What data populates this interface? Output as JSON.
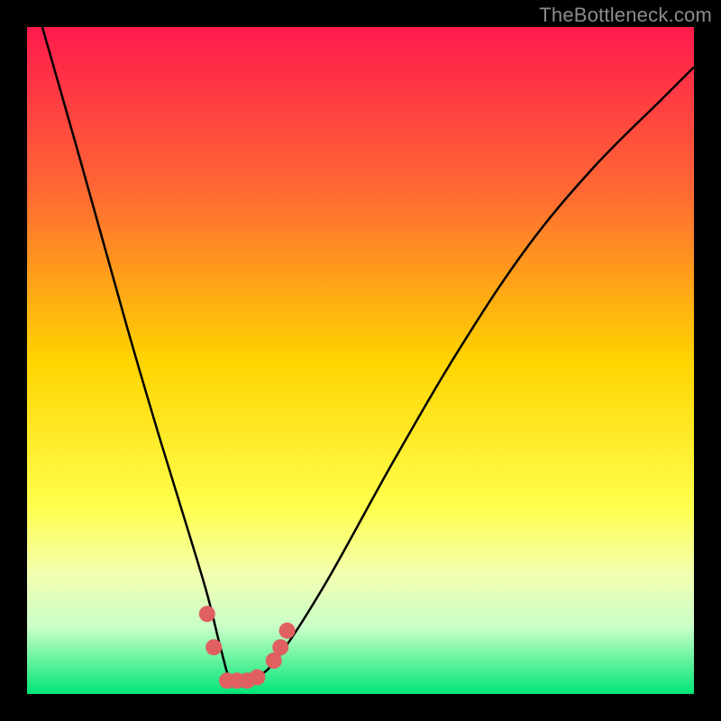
{
  "watermark": "TheBottleneck.com",
  "chart_data": {
    "type": "line",
    "title": "",
    "xlabel": "",
    "ylabel": "",
    "xlim": [
      0,
      100
    ],
    "ylim": [
      0,
      100
    ],
    "background_gradient": {
      "stops": [
        {
          "offset": 0,
          "color": "#ff1a4d"
        },
        {
          "offset": 25,
          "color": "#ff6a33"
        },
        {
          "offset": 50,
          "color": "#ffd400"
        },
        {
          "offset": 72,
          "color": "#ffff4d"
        },
        {
          "offset": 82,
          "color": "#f3ffb0"
        },
        {
          "offset": 90,
          "color": "#c8ffc8"
        },
        {
          "offset": 100,
          "color": "#00e676"
        }
      ]
    },
    "series": [
      {
        "name": "bottleneck-curve",
        "color": "#000000",
        "x": [
          0,
          8,
          15,
          20,
          24,
          27,
          29,
          30.5,
          32,
          34.5,
          38,
          45,
          55,
          65,
          75,
          85,
          95,
          100
        ],
        "y": [
          108,
          80,
          55,
          38,
          25,
          15,
          7,
          2,
          2,
          2.5,
          6,
          17,
          35,
          52,
          67,
          79,
          89,
          94
        ]
      }
    ],
    "markers": {
      "name": "recommended-points",
      "color": "#e06060",
      "radius": 9,
      "points": [
        {
          "x": 27.0,
          "y": 12.0
        },
        {
          "x": 28.0,
          "y": 7.0
        },
        {
          "x": 30.0,
          "y": 2.0
        },
        {
          "x": 31.5,
          "y": 2.0
        },
        {
          "x": 33.0,
          "y": 2.0
        },
        {
          "x": 34.5,
          "y": 2.5
        },
        {
          "x": 37.0,
          "y": 5.0
        },
        {
          "x": 38.0,
          "y": 7.0
        },
        {
          "x": 39.0,
          "y": 9.5
        }
      ]
    }
  }
}
